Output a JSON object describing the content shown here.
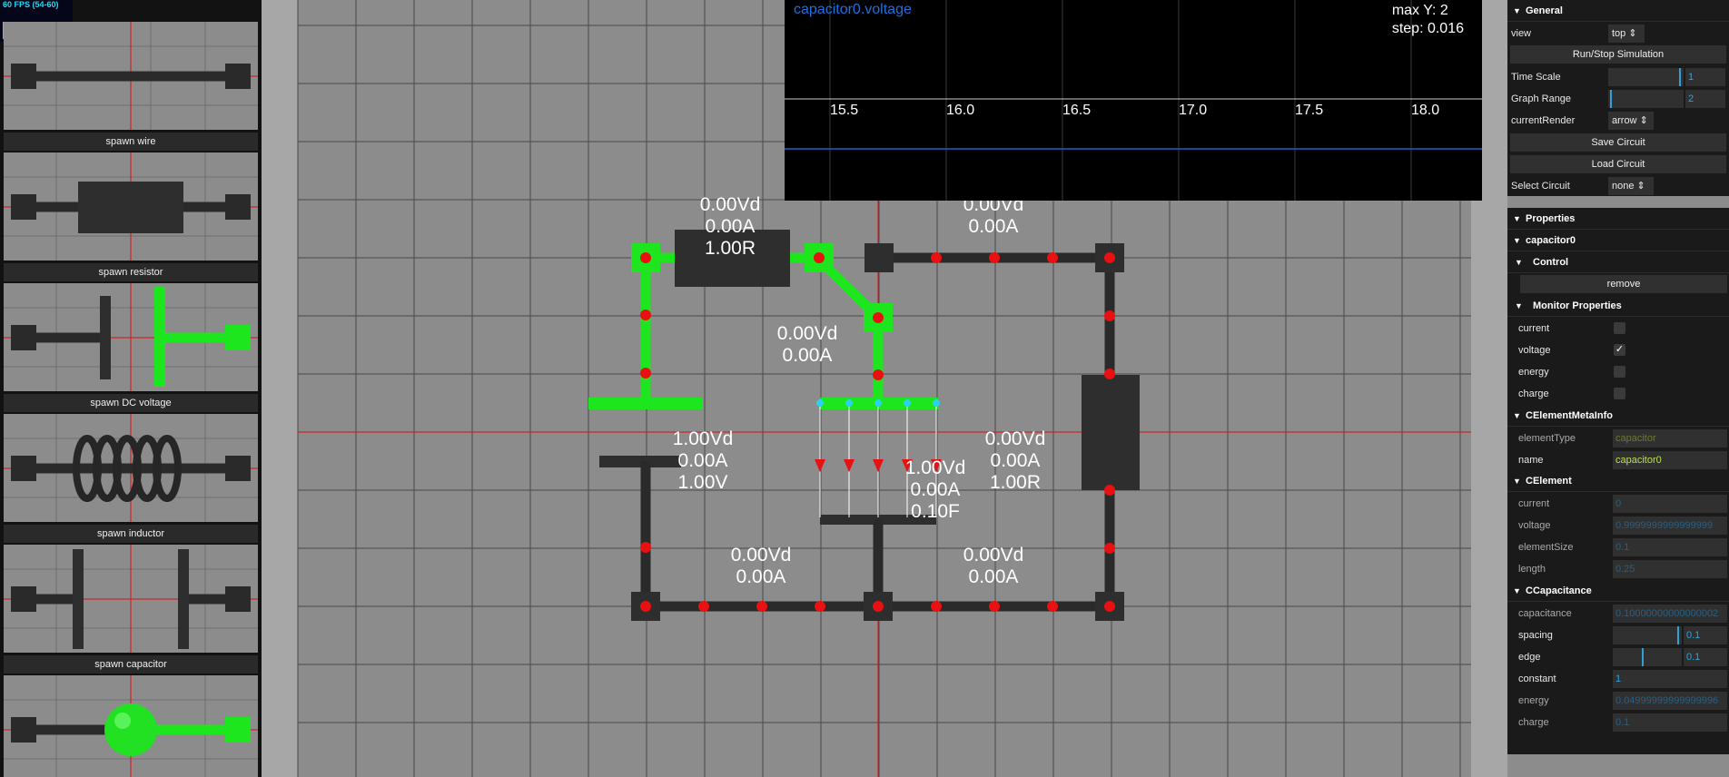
{
  "fps": {
    "text": "60 FPS (54-60)",
    "level": 1.0
  },
  "palette": [
    {
      "label": "spawn wire",
      "icon": "wire-icon"
    },
    {
      "label": "spawn resistor",
      "icon": "resistor-icon"
    },
    {
      "label": "spawn DC voltage",
      "icon": "dc-voltage-icon"
    },
    {
      "label": "spawn inductor",
      "icon": "inductor-icon"
    },
    {
      "label": "spawn capacitor",
      "icon": "capacitor-icon"
    },
    {
      "label": "",
      "icon": "probe-icon"
    }
  ],
  "graph": {
    "title": "capacitor0.voltage",
    "max_y": "max Y: 2",
    "step": "step: 0.016",
    "ticks": [
      "15.5",
      "16.0",
      "16.5",
      "17.0",
      "17.5",
      "18.0"
    ]
  },
  "circuit_labels": [
    {
      "id": "resistor-top",
      "lines": [
        "0.00Vd",
        "0.00A",
        "1.00R"
      ]
    },
    {
      "id": "wire-top-right",
      "lines": [
        "0.00Vd",
        "0.00A"
      ]
    },
    {
      "id": "wire-diag",
      "lines": [
        "0.00Vd",
        "0.00A"
      ]
    },
    {
      "id": "dc-source",
      "lines": [
        "1.00Vd",
        "0.00A",
        "1.00V"
      ]
    },
    {
      "id": "capacitor",
      "lines": [
        "1.00Vd",
        "0.00A",
        "0.10F"
      ]
    },
    {
      "id": "resistor-right",
      "lines": [
        "0.00Vd",
        "0.00A",
        "1.00R"
      ]
    },
    {
      "id": "wire-bottom-left",
      "lines": [
        "0.00Vd",
        "0.00A"
      ]
    },
    {
      "id": "wire-bottom-right",
      "lines": [
        "0.00Vd",
        "0.00A"
      ]
    }
  ],
  "panel": {
    "general": {
      "title": "General",
      "view_label": "view",
      "view_value": "top",
      "run_button": "Run/Stop Simulation",
      "time_scale_label": "Time Scale",
      "time_scale_value": "1",
      "time_scale_level": 0.96,
      "graph_range_label": "Graph Range",
      "graph_range_value": "2",
      "graph_range_level": 0.05,
      "render_label": "currentRender",
      "render_value": "arrow",
      "save_button": "Save Circuit",
      "load_button": "Load Circuit",
      "select_label": "Select Circuit",
      "select_value": "none"
    },
    "properties": {
      "title": "Properties",
      "element_title": "capacitor0",
      "control_title": "Control",
      "remove_button": "remove",
      "monitor_title": "Monitor Properties",
      "monitor": [
        {
          "label": "current",
          "checked": false
        },
        {
          "label": "voltage",
          "checked": true
        },
        {
          "label": "energy",
          "checked": false
        },
        {
          "label": "charge",
          "checked": false
        }
      ],
      "meta_title": "CElementMetaInfo",
      "element_type_label": "elementType",
      "element_type_value": "capacitor",
      "name_label": "name",
      "name_value": "capacitor0",
      "celement_title": "CElement",
      "current_label": "current",
      "current_value": "0",
      "voltage_label": "voltage",
      "voltage_value": "0.9999999999999999",
      "element_size_label": "elementSize",
      "element_size_value": "0.1",
      "length_label": "length",
      "length_value": "0.25",
      "ccap_title": "CCapacitance",
      "capacitance_label": "capacitance",
      "capacitance_value": "0.10000000000000002",
      "spacing_label": "spacing",
      "spacing_value": "0.1",
      "spacing_level": 0.96,
      "edge_label": "edge",
      "edge_value": "0.1",
      "edge_level": 0.45,
      "constant_label": "constant",
      "constant_value": "1",
      "energy_label": "energy",
      "energy_value": "0.04999999999999996",
      "charge_label": "charge",
      "charge_value": "0.1"
    }
  },
  "colors": {
    "active_wire": "#1ee61e",
    "inactive_wire": "#2a2a2a",
    "node": "#e81010",
    "grid": "#4a4a4a",
    "axis": "#dd1111",
    "accent": "#2fa1d6"
  }
}
